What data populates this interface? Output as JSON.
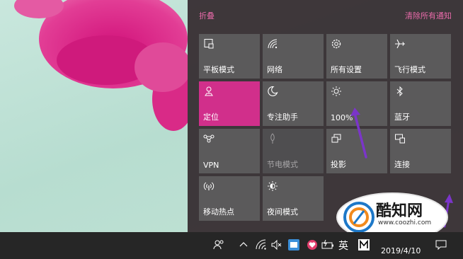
{
  "colors": {
    "accent": "#d12f8b",
    "tile": "#5b5a5b",
    "panel": "#342a2e",
    "link": "#e86aa9"
  },
  "action_center": {
    "collapse_label": "折叠",
    "clear_label": "清除所有通知",
    "tiles": [
      {
        "label": "平板模式",
        "icon": "tablet-mode-icon",
        "state": "off"
      },
      {
        "label": "网络",
        "icon": "network-icon",
        "state": "off"
      },
      {
        "label": "所有设置",
        "icon": "settings-gear-icon",
        "state": "off"
      },
      {
        "label": "飞行模式",
        "icon": "airplane-icon",
        "state": "off"
      },
      {
        "label": "定位",
        "icon": "location-icon",
        "state": "on"
      },
      {
        "label": "专注助手",
        "icon": "moon-icon",
        "state": "off"
      },
      {
        "label": "100%",
        "icon": "brightness-icon",
        "state": "off"
      },
      {
        "label": "蓝牙",
        "icon": "bluetooth-icon",
        "state": "off"
      },
      {
        "label": "VPN",
        "icon": "vpn-icon",
        "state": "off"
      },
      {
        "label": "节电模式",
        "icon": "battery-saver-icon",
        "state": "disabled"
      },
      {
        "label": "投影",
        "icon": "project-icon",
        "state": "off"
      },
      {
        "label": "连接",
        "icon": "connect-icon",
        "state": "off"
      },
      {
        "label": "移动热点",
        "icon": "mobile-hotspot-icon",
        "state": "off"
      },
      {
        "label": "夜间模式",
        "icon": "night-light-icon",
        "state": "off"
      }
    ]
  },
  "taskbar": {
    "ime_label": "英",
    "date": "2019/4/10"
  },
  "watermark": {
    "text": "酷知网",
    "url": "www.coozhi.com"
  }
}
